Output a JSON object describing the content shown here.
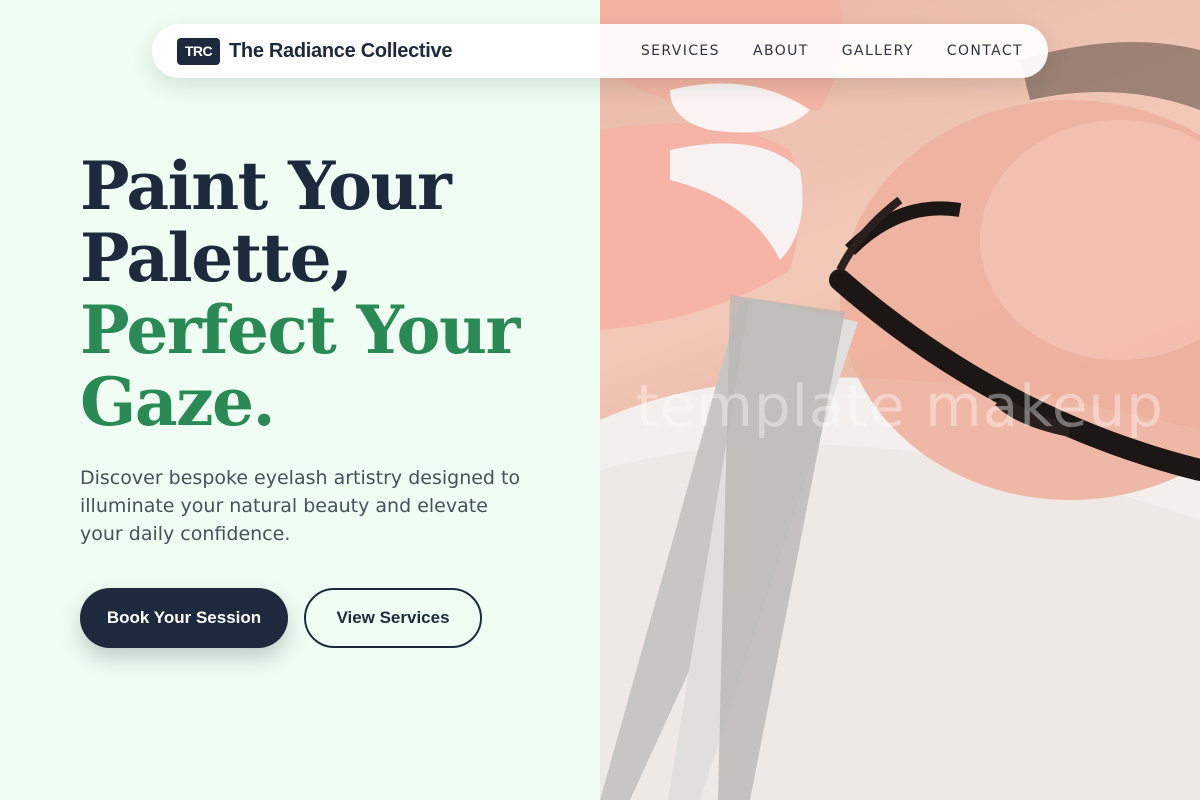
{
  "header": {
    "logo_badge": "TRC",
    "brand_name": "The Radiance Collective",
    "nav": [
      "SERVICES",
      "ABOUT",
      "GALLERY",
      "CONTACT"
    ]
  },
  "hero": {
    "headline_line1": "Paint Your",
    "headline_line2": "Palette,",
    "headline_line3": "Perfect Your",
    "headline_line4": "Gaze.",
    "subtext": "Discover bespoke eyelash artistry designed to illuminate your natural beauty and elevate your daily confidence.",
    "primary_button": "Book Your Session",
    "secondary_button": "View Services",
    "image_watermark": "template makeup"
  },
  "colors": {
    "background": "#effdf2",
    "navy": "#1d2a3d",
    "accent_green": "#2a8a55"
  }
}
